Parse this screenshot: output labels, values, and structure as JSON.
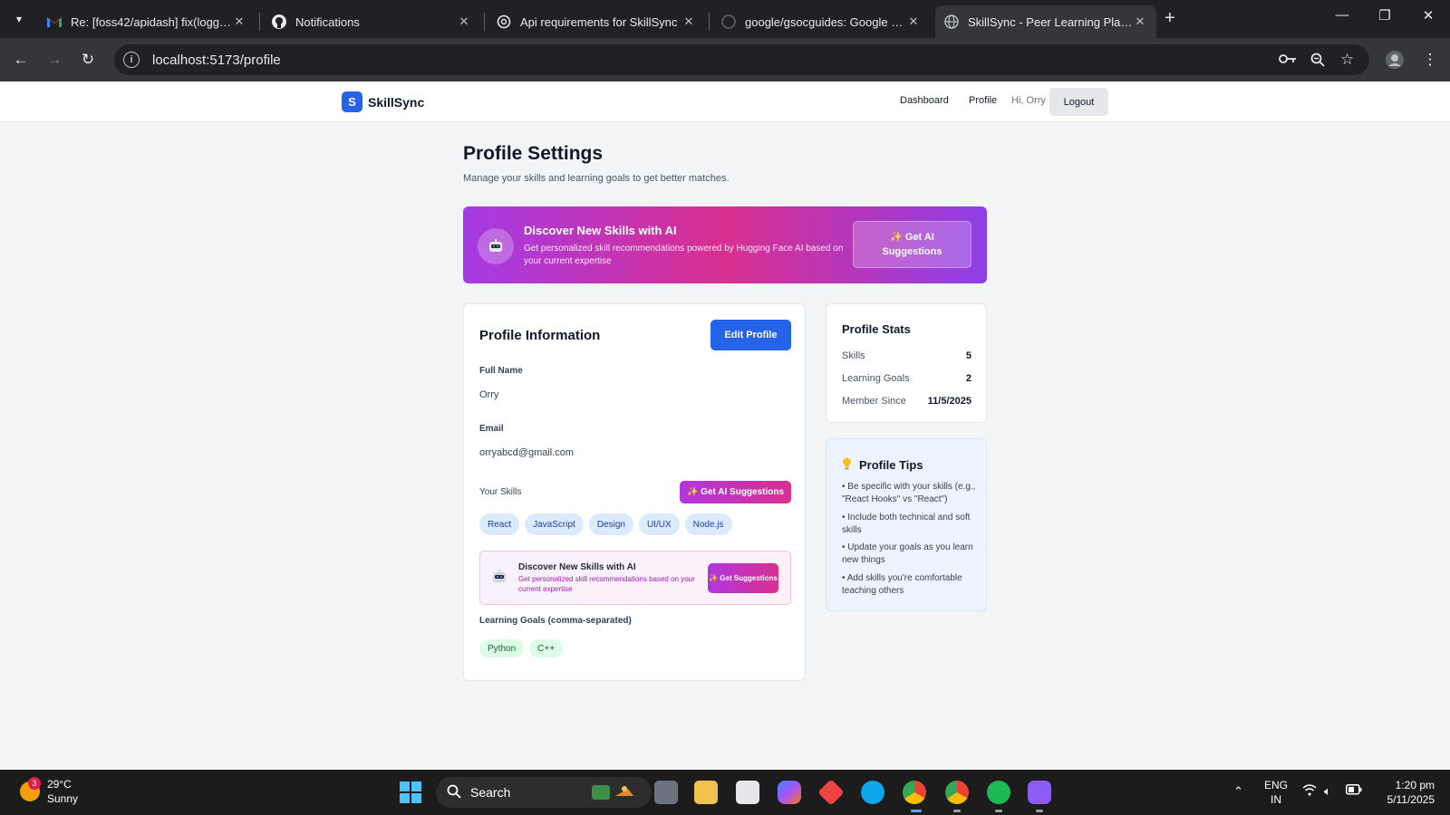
{
  "browser": {
    "tabs": [
      {
        "title": "Re: [foss42/apidash] fix(logging",
        "icon": "gmail-icon"
      },
      {
        "title": "Notifications",
        "icon": "github-icon"
      },
      {
        "title": "Api requirements for SkillSync",
        "icon": "chatgpt-icon"
      },
      {
        "title": "google/gsocguides: Google Sur",
        "icon": "github-icon"
      },
      {
        "title": "SkillSync - Peer Learning Platfor",
        "icon": "globe-icon",
        "active": true
      }
    ],
    "url": "localhost:5173/profile"
  },
  "header": {
    "brand_letter": "S",
    "brand_name": "SkillSync",
    "nav": {
      "dashboard": "Dashboard",
      "profile": "Profile",
      "greeting": "Hi, Orry",
      "logout": "Logout"
    }
  },
  "page": {
    "title": "Profile Settings",
    "subtitle": "Manage your skills and learning goals to get better matches."
  },
  "ai_banner": {
    "title": "Discover New Skills with AI",
    "description": "Get personalized skill recommendations powered by Hugging Face AI based on your current expertise",
    "button": "✨ Get AI Suggestions"
  },
  "profile_info": {
    "title": "Profile Information",
    "edit_button": "Edit Profile",
    "full_name_label": "Full Name",
    "full_name": "Orry",
    "email_label": "Email",
    "email": "orryabcd@gmail.com",
    "skills_label": "Your Skills",
    "skills_ai_button": "✨ Get AI Suggestions",
    "skills": [
      "React",
      "JavaScript",
      "Design",
      "UI/UX",
      "Node.js"
    ],
    "mini_banner": {
      "title": "Discover New Skills with AI",
      "description": "Get personalized skill recommendations based on your current expertise",
      "button": "✨ Get Suggestions"
    },
    "goals_label": "Learning Goals (comma-separated)",
    "goals": [
      "Python",
      "C++"
    ]
  },
  "stats": {
    "title": "Profile Stats",
    "rows": [
      {
        "label": "Skills",
        "value": "5"
      },
      {
        "label": "Learning Goals",
        "value": "2"
      },
      {
        "label": "Member Since",
        "value": "11/5/2025"
      }
    ]
  },
  "tips": {
    "title": "Profile Tips",
    "items": [
      "• Be specific with your skills (e.g., \"React Hooks\" vs \"React\")",
      "• Include both technical and soft skills",
      "• Update your goals as you learn new things",
      "• Add skills you're comfortable teaching others"
    ]
  },
  "taskbar": {
    "weather_temp": "29°C",
    "weather_desc": "Sunny",
    "weather_badge": "3",
    "search_placeholder": "Search",
    "lang_line1": "ENG",
    "lang_line2": "IN",
    "time": "1:20 pm",
    "date": "5/11/2025"
  },
  "colors": {
    "primary": "#2563eb",
    "ai_gradient_start": "#a43be4",
    "ai_gradient_mid": "#d92f8f",
    "skill_chip": "#dbeafe",
    "goal_chip": "#dcfce7"
  }
}
